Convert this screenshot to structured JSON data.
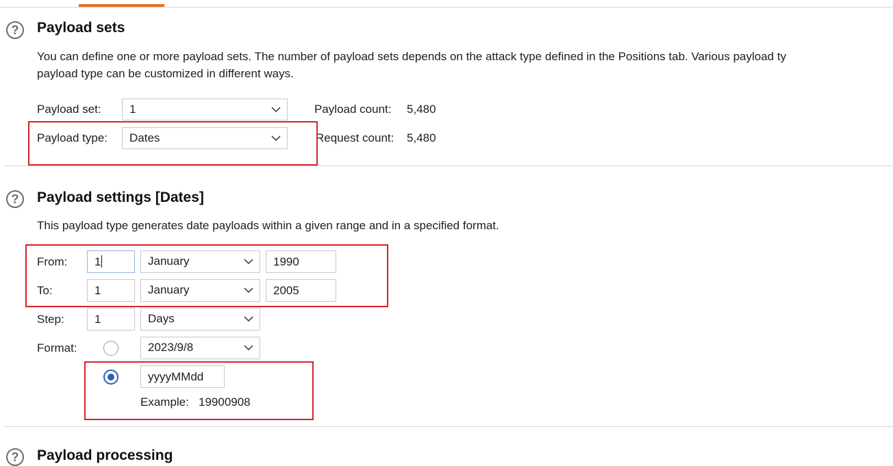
{
  "payload_sets": {
    "title": "Payload sets",
    "desc_line1": "You can define one or more payload sets. The number of payload sets depends on the attack type defined in the Positions tab. Various payload ty",
    "desc_line2": "payload type can be customized in different ways.",
    "set_label": "Payload set:",
    "set_value": "1",
    "type_label": "Payload type:",
    "type_value": "Dates",
    "payload_count_label": "Payload count:",
    "payload_count": "5,480",
    "request_count_label": "Request count:",
    "request_count": "5,480"
  },
  "payload_settings": {
    "title": "Payload settings [Dates]",
    "desc": "This payload type generates date payloads within a given range and in a specified format.",
    "from_label": "From:",
    "from_day": "1",
    "from_month": "January",
    "from_year": "1990",
    "to_label": "To:",
    "to_day": "1",
    "to_month": "January",
    "to_year": "2005",
    "step_label": "Step:",
    "step_value": "1",
    "step_unit": "Days",
    "format_label": "Format:",
    "format_preset": "2023/9/8",
    "format_custom": "yyyyMMdd",
    "example_label": "Example:",
    "example_value": "19900908"
  },
  "next_section": {
    "title": "Payload processing"
  },
  "icons": {
    "help": "help-circle-icon",
    "dropdown": "chevron-down-icon"
  },
  "colors": {
    "accent_tab": "#e8702a",
    "highlight_box": "#d6222a",
    "radio_selected": "#2563b5"
  }
}
